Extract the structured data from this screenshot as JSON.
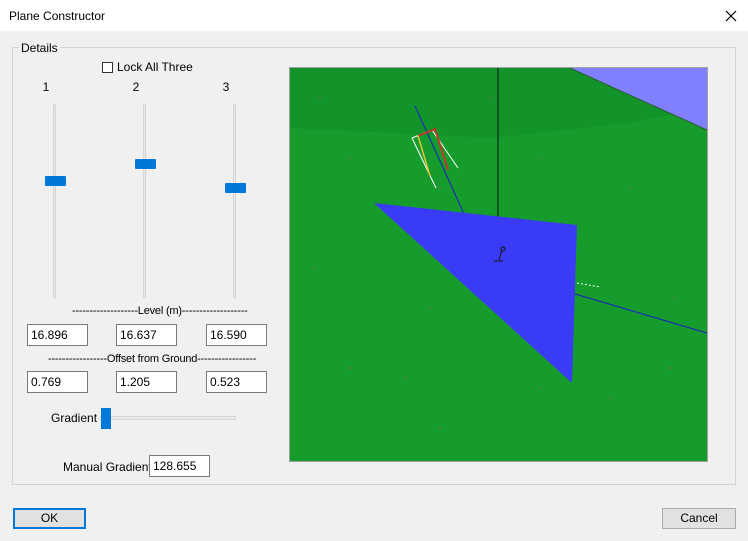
{
  "window": {
    "title": "Plane Constructor",
    "close_icon": "close-icon"
  },
  "details": {
    "group_label": "Details",
    "lock_all_three": {
      "label": "Lock All Three",
      "checked": false
    },
    "sliders": [
      {
        "label": "1",
        "level_fraction": 0.39
      },
      {
        "label": "2",
        "level_fraction": 0.3
      },
      {
        "label": "3",
        "level_fraction": 0.43
      }
    ],
    "level_heading": "-------------------Level (m)-------------------",
    "levels": [
      "16.896",
      "16.637",
      "16.590"
    ],
    "offset_heading": "-----------------Offset from Ground-----------------",
    "offsets": [
      "0.769",
      "1.205",
      "0.523"
    ],
    "gradient": {
      "label": "Gradient",
      "slider_fraction": 0.0
    },
    "manual_gradient": {
      "label": "Manual Gradient",
      "value": "128.655"
    }
  },
  "buttons": {
    "ok": "OK",
    "cancel": "Cancel"
  },
  "colors": {
    "accent": "#0078d7",
    "ground": "#159a2c",
    "plane": "#3a3cf5",
    "sky": "#8080ff"
  }
}
